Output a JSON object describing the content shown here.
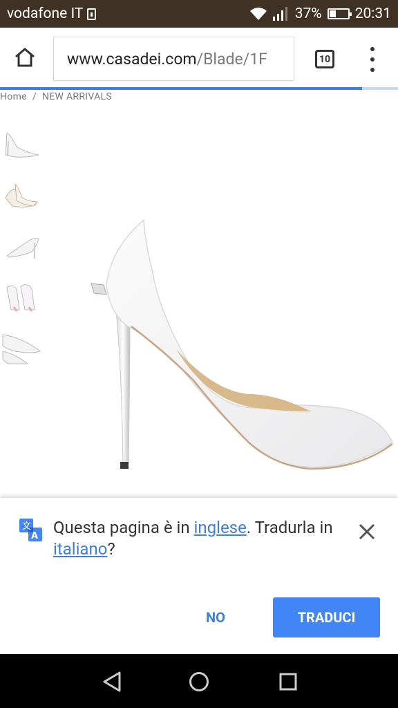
{
  "status_bar": {
    "carrier": "vodafone IT",
    "battery_percent": "37%",
    "battery_level": 0.37,
    "time": "20:31",
    "icons": [
      "sim-icon",
      "wifi-icon",
      "signal-icon",
      "battery-icon"
    ]
  },
  "browser": {
    "url_domain": "www.casadei.com",
    "url_path": "/Blade/1F",
    "tab_count": "10",
    "load_progress": 0.91,
    "icons": [
      "home-icon",
      "tabs-icon",
      "overflow-menu-icon"
    ]
  },
  "page": {
    "breadcrumb": [
      "Home",
      "/",
      "NEW ARRIVALS"
    ],
    "thumbnail_count": 5,
    "main_image": "white-stiletto-pump"
  },
  "translate_bar": {
    "text_before": "Questa pagina è in ",
    "source_language": "inglese",
    "text_middle": ". Tradurla in ",
    "target_language": "italiano",
    "text_after": "?",
    "no_label": "NO",
    "translate_label": "TRADUCI",
    "accent_color": "#4285f4",
    "icons": [
      "translate-icon",
      "close-icon"
    ]
  },
  "nav_bar": {
    "icons": [
      "back-triangle-icon",
      "home-circle-icon",
      "recents-square-icon"
    ]
  }
}
